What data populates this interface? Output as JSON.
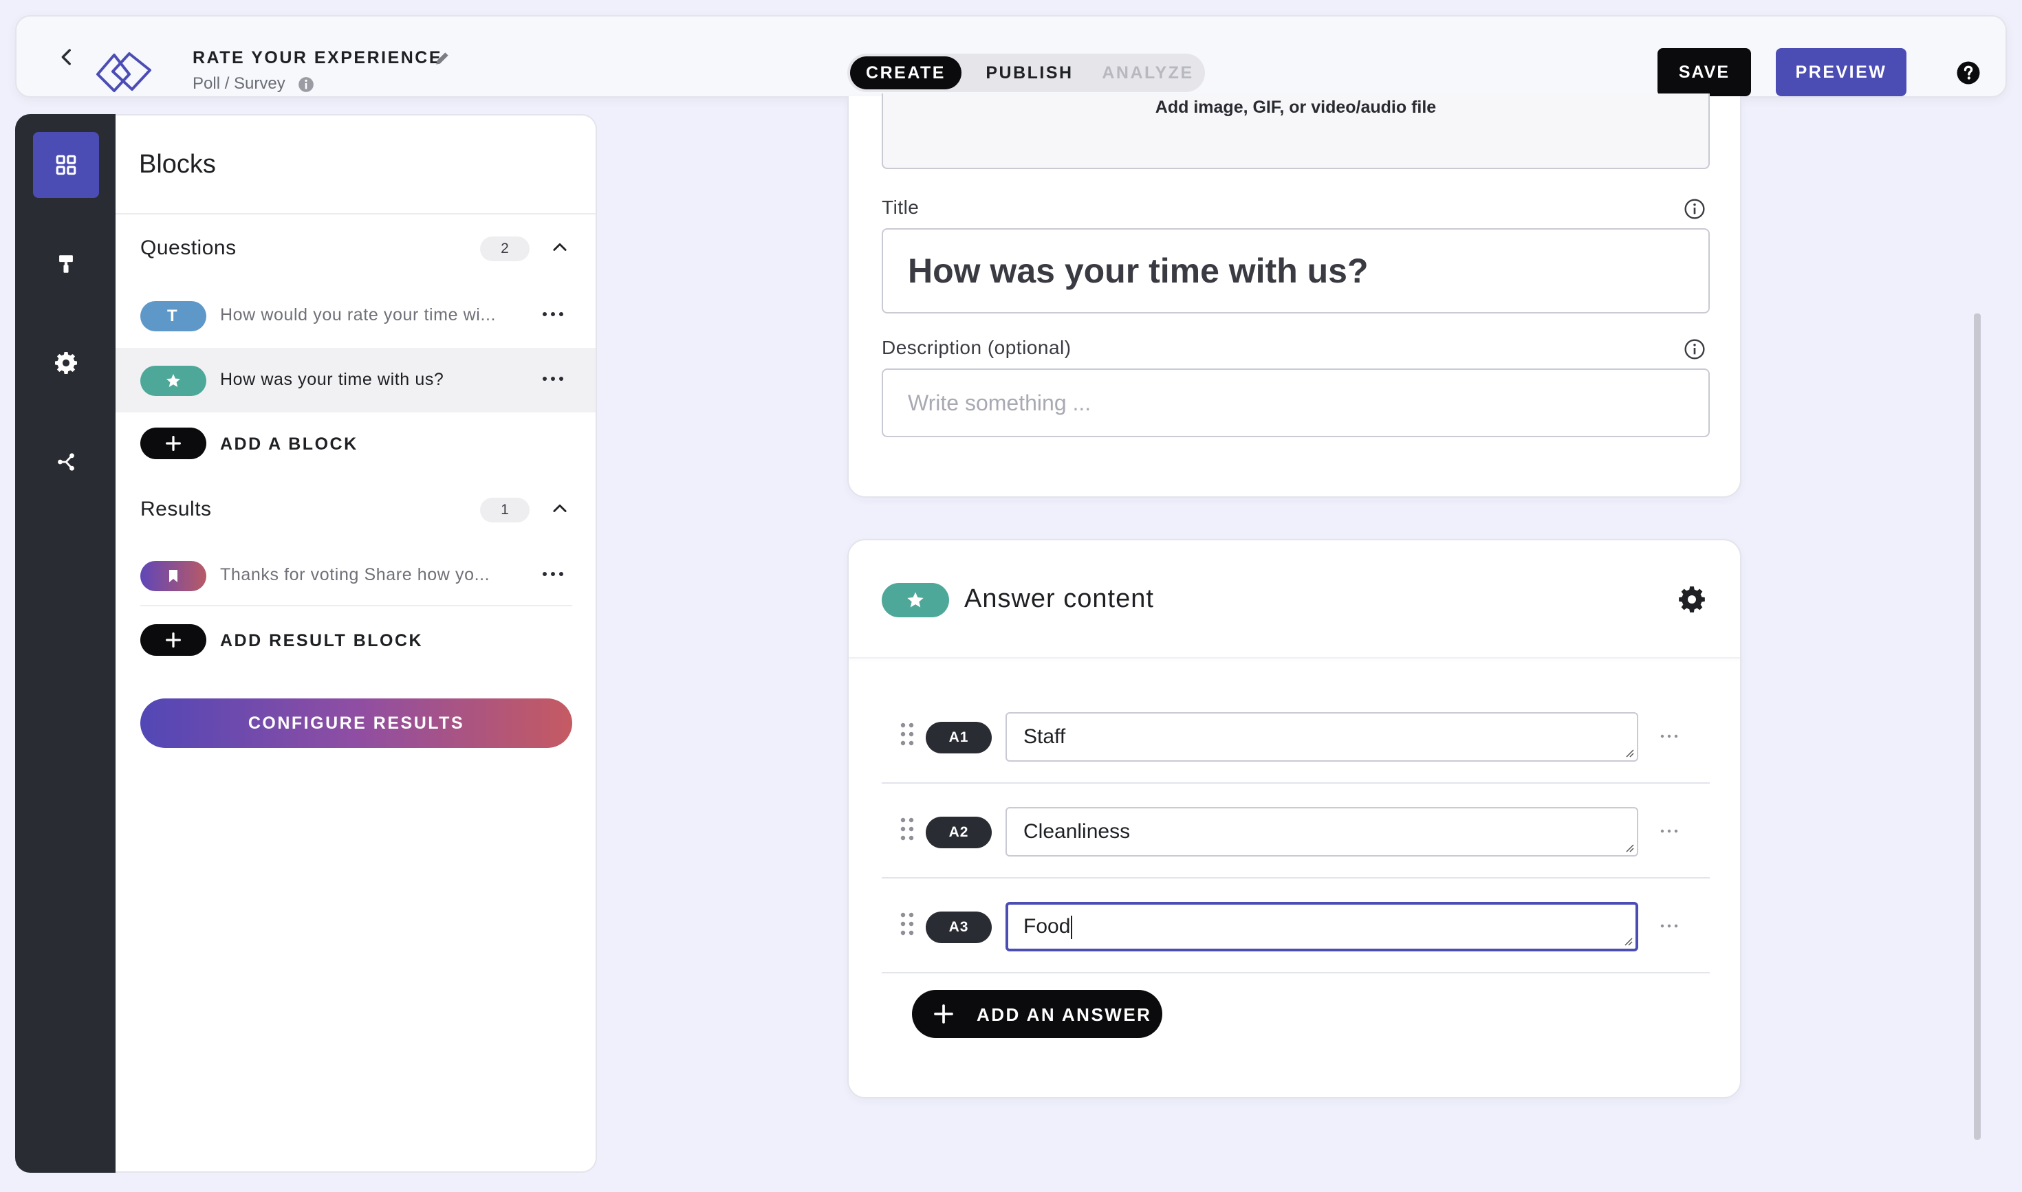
{
  "header": {
    "title": "RATE YOUR EXPERIENCE",
    "subtitle": "Poll / Survey",
    "tabs": [
      {
        "label": "CREATE",
        "state": "active"
      },
      {
        "label": "PUBLISH",
        "state": "enabled"
      },
      {
        "label": "ANALYZE",
        "state": "disabled"
      }
    ],
    "save_label": "SAVE",
    "preview_label": "PREVIEW"
  },
  "rail": {
    "items": [
      {
        "icon": "grid-icon",
        "active": true
      },
      {
        "icon": "paint-roller-icon",
        "active": false
      },
      {
        "icon": "gear-icon",
        "active": false
      },
      {
        "icon": "share-icon",
        "active": false
      }
    ]
  },
  "sidebar": {
    "title": "Blocks",
    "questions": {
      "label": "Questions",
      "count": "2",
      "items": [
        {
          "type_letter": "T",
          "icon": "text-type-icon",
          "text": "How would you rate your time wi...",
          "selected": false
        },
        {
          "icon": "star-icon",
          "text": "How was your time with us?",
          "selected": true
        }
      ],
      "add_label": "ADD A BLOCK"
    },
    "results": {
      "label": "Results",
      "count": "1",
      "items": [
        {
          "icon": "bookmark-icon",
          "text": "Thanks for voting Share how yo..."
        }
      ],
      "add_label": "ADD RESULT BLOCK"
    },
    "configure_label": "CONFIGURE RESULTS"
  },
  "editor": {
    "media_label": "Add image, GIF, or video/audio file",
    "title_label": "Title",
    "title_value": "How was your time with us?",
    "description_label": "Description (optional)",
    "description_placeholder": "Write something ...",
    "answers": {
      "title": "Answer content",
      "items": [
        {
          "badge": "A1",
          "value": "Staff",
          "focused": false
        },
        {
          "badge": "A2",
          "value": "Cleanliness",
          "focused": false
        },
        {
          "badge": "A3",
          "value": "Food",
          "focused": true
        }
      ],
      "add_label": "ADD AN ANSWER"
    }
  },
  "colors": {
    "accent": "#4b4db5",
    "background": "#eff0fb",
    "rail": "#2a2c33",
    "star_pill": "#4ea89a",
    "text_pill": "#5d98c8"
  }
}
